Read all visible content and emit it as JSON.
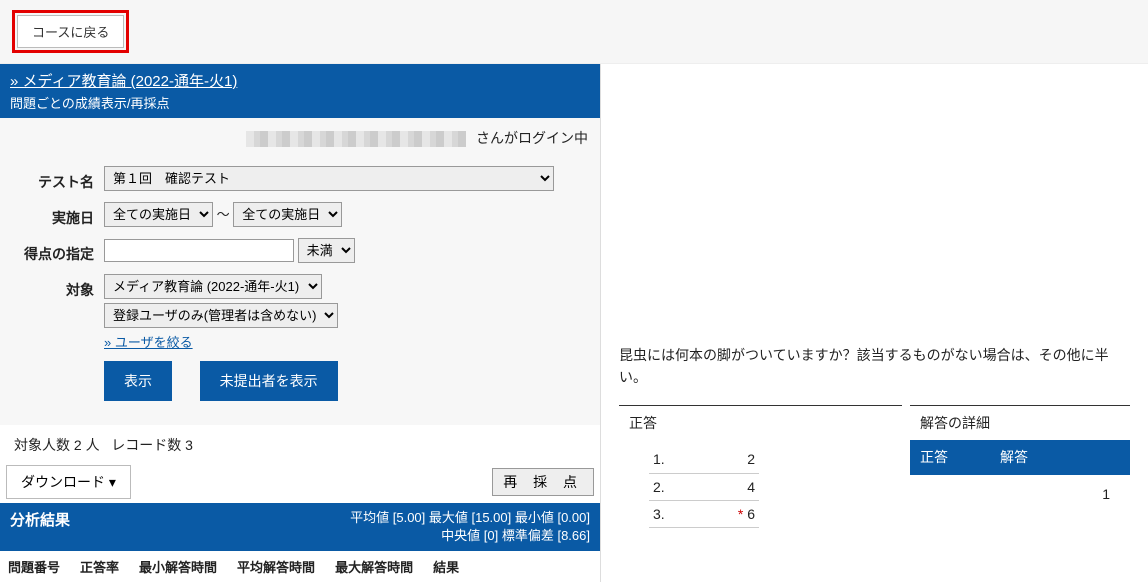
{
  "topbar": {
    "back_label": "コースに戻る"
  },
  "header": {
    "course_link": "» メディア教育論 (2022-通年-火1)",
    "subtitle": "問題ごとの成績表示/再採点"
  },
  "login": {
    "suffix": "さんがログイン中"
  },
  "form": {
    "test_label": "テスト名",
    "test_value": "第１回　確認テスト",
    "date_label": "実施日",
    "date_all": "全ての実施日",
    "date_sep": "～",
    "score_label": "得点の指定",
    "score_condition": "未満",
    "target_label": "対象",
    "target_course": "メディア教育論 (2022-通年-火1)",
    "target_users": "登録ユーザのみ(管理者は含めない)",
    "filter_users_link": "» ユーザを絞る",
    "show_btn": "表示",
    "unsubmitted_btn": "未提出者を表示"
  },
  "counts": {
    "target_prefix": "対象人数",
    "target_value": "2 人",
    "record_prefix": "レコード数",
    "record_value": "3"
  },
  "download": {
    "label": "ダウンロード",
    "caret": "▾",
    "rescore": "再 採 点"
  },
  "analysis": {
    "title": "分析結果",
    "stats_line1": "平均値 [5.00]  最大値 [15.00]  最小値 [0.00]",
    "stats_line2": "中央値 [0]  標準偏差 [8.66]",
    "cols": [
      "問題番号",
      "正答率",
      "最小解答時間",
      "平均解答時間",
      "最大解答時間",
      "結果"
    ]
  },
  "right": {
    "question_text": "昆虫には何本の脚がついていますか？該当するものがない場合は、その他に半い。",
    "correct_title": "正答",
    "detail_title": "解答の詳細",
    "options": [
      {
        "no": "1.",
        "val": "2"
      },
      {
        "no": "2.",
        "val": "4"
      },
      {
        "no": "3.",
        "val": "6",
        "mark": "*"
      }
    ],
    "detail_cols": {
      "correct": "正答",
      "answer": "解答"
    },
    "detail_value": "1"
  }
}
